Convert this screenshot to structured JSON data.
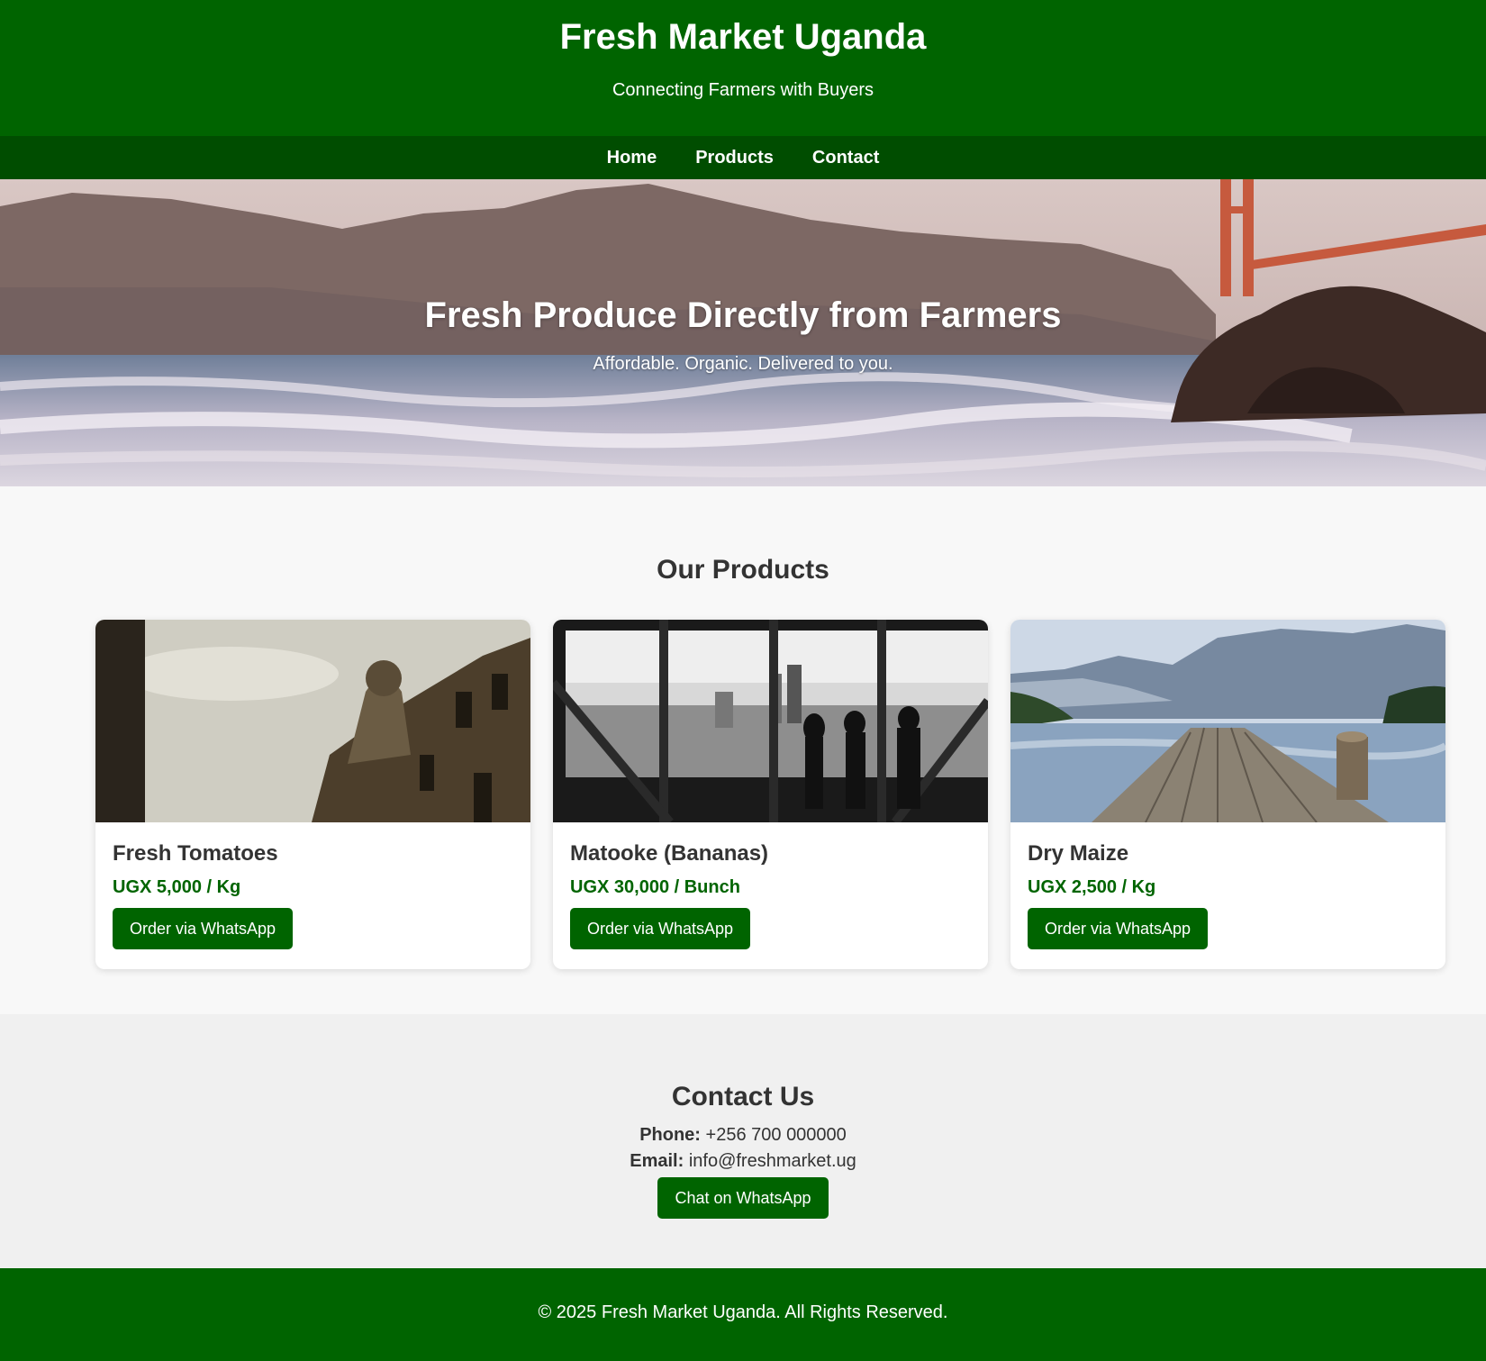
{
  "header": {
    "title": "Fresh Market Uganda",
    "tagline": "Connecting Farmers with Buyers"
  },
  "nav": {
    "items": [
      "Home",
      "Products",
      "Contact"
    ]
  },
  "hero": {
    "title": "Fresh Produce Directly from Farmers",
    "subtitle": "Affordable. Organic. Delivered to you."
  },
  "products": {
    "heading": "Our Products",
    "items": [
      {
        "name": "Fresh Tomatoes",
        "price": "UGX 5,000 / Kg",
        "button": "Order via WhatsApp"
      },
      {
        "name": "Matooke (Bananas)",
        "price": "UGX 30,000 / Bunch",
        "button": "Order via WhatsApp"
      },
      {
        "name": "Dry Maize",
        "price": "UGX 2,500 / Kg",
        "button": "Order via WhatsApp"
      }
    ]
  },
  "contact": {
    "heading": "Contact Us",
    "phone_label": "Phone:",
    "phone": "+256 700 000000",
    "email_label": "Email:",
    "email": "info@freshmarket.ug",
    "button": "Chat on WhatsApp"
  },
  "footer": {
    "text": "© 2025 Fresh Market Uganda. All Rights Reserved."
  },
  "colors": {
    "brand_green": "#006400",
    "nav_green": "#004d00"
  }
}
